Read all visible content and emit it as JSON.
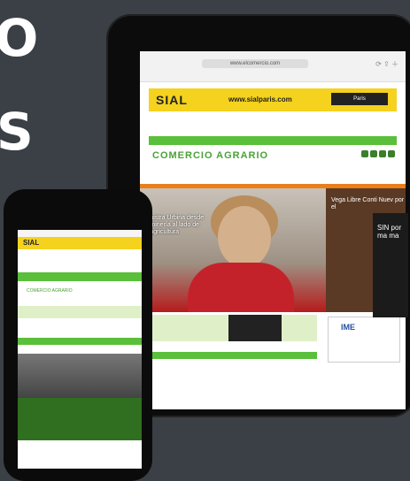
{
  "header_text": {
    "line1": "O",
    "line2": "S"
  },
  "tablet": {
    "url": "www.elcomercio.com",
    "banner": {
      "logo": "SIAL",
      "site": "www.sialparis.com",
      "date_badge": "Paris"
    },
    "brand": "COMERCIO AGRARIO",
    "hero_caption": "Ministra Urbina desde la minería al lado de la agricultura",
    "side_caption": "Vega Libre Conti Nuev por el",
    "ime_label": "IME",
    "overlay_text": "SIN por ma ma"
  },
  "phone": {
    "banner_logo": "SIAL",
    "brand": "COMERCIO AGRARIO"
  },
  "colors": {
    "background": "#3b4046",
    "green": "#5abf3a",
    "yellow": "#f4d21e",
    "orange": "#e97e1a"
  }
}
